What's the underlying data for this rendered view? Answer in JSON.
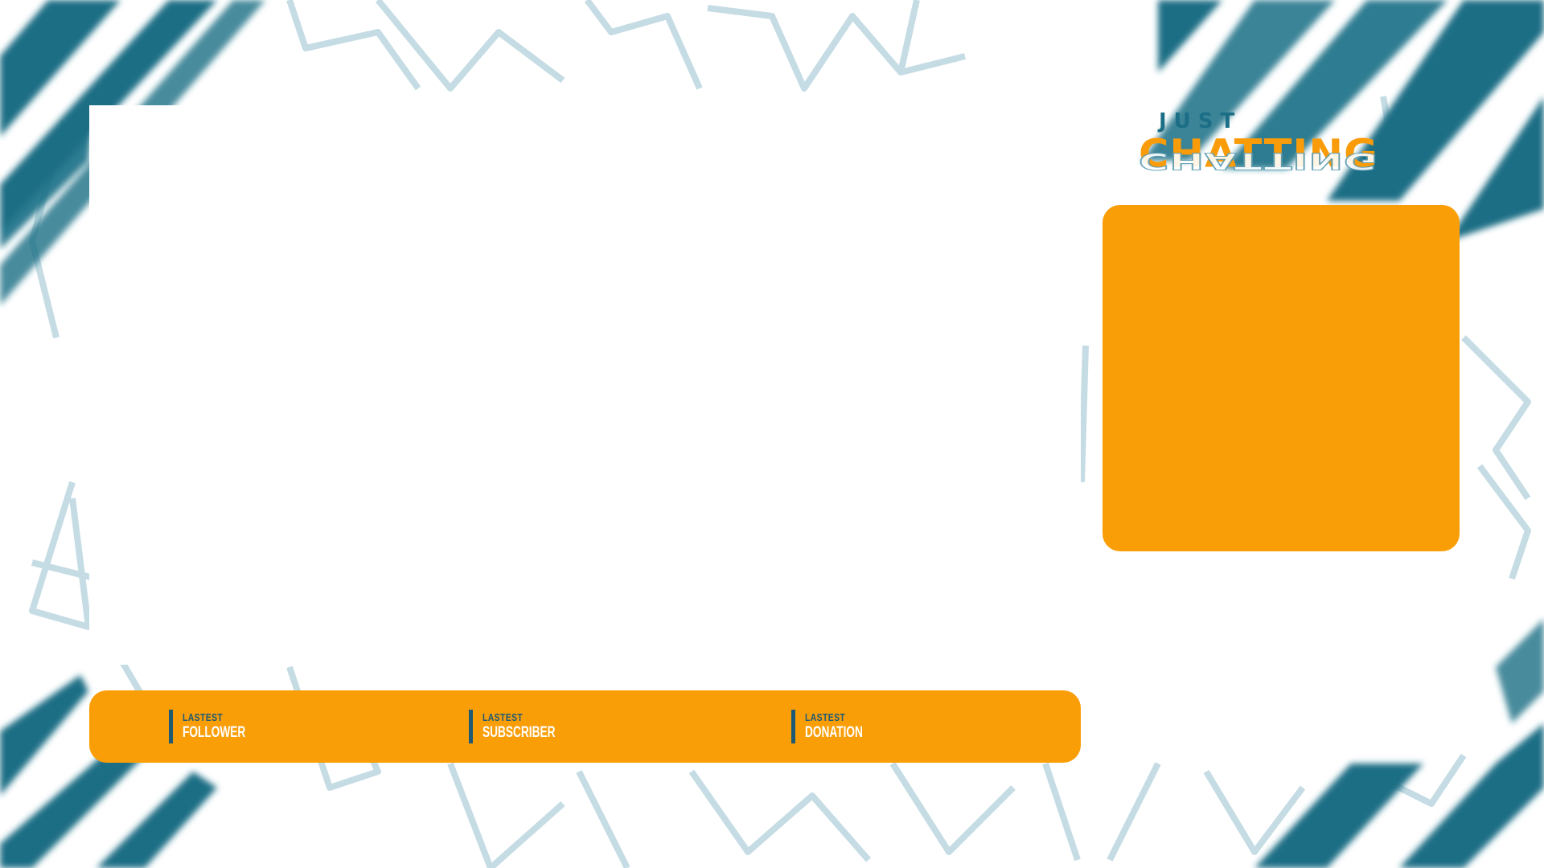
{
  "title": {
    "line1": "JUST",
    "line2": "CHATTING"
  },
  "stats": [
    {
      "line1": "LASTEST",
      "line2": "FOLLOWER"
    },
    {
      "line1": "LASTEST",
      "line2": "SUBSCRIBER"
    },
    {
      "line1": "LASTEST",
      "line2": "DONATION"
    }
  ],
  "colors": {
    "accent_orange": "#fa9e08",
    "accent_teal": "#1b6e85",
    "outline_light_blue": "#c5dce4",
    "background": "#ffffff"
  }
}
